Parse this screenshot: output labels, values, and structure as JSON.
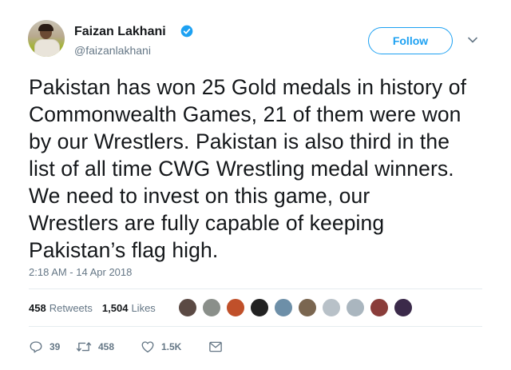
{
  "author": {
    "name": "Faizan Lakhani",
    "handle": "@faizanlakhani",
    "verified": true
  },
  "follow_button": {
    "label": "Follow"
  },
  "tweet": {
    "lines": [
      "Pakistan has won 25 Gold medals in history of",
      "Commonwealth Games, 21 of them were won",
      "by our Wrestlers. Pakistan is also third in the",
      "list of all time CWG Wrestling medal winners.",
      "We need to invest on this game, our",
      "Wrestlers are fully capable of keeping",
      "Pakistan’s flag high."
    ],
    "timestamp": "2:18 AM - 14 Apr 2018"
  },
  "stats": {
    "retweets_count": "458",
    "retweets_label": "Retweets",
    "likes_count": "1,504",
    "likes_label": "Likes"
  },
  "liker_avatars": [
    {
      "color": "#5b4a44"
    },
    {
      "color": "#8a8f8a"
    },
    {
      "color": "#c0502a"
    },
    {
      "color": "#222222"
    },
    {
      "color": "#6d8fa8"
    },
    {
      "color": "#7a6650"
    },
    {
      "color": "#b8c1c8"
    },
    {
      "color": "#aab6bf"
    },
    {
      "color": "#8a3d3a"
    },
    {
      "color": "#3b2a4a"
    }
  ],
  "actions": {
    "reply_count": "39",
    "retweet_count": "458",
    "like_count": "1.5K"
  },
  "colors": {
    "accent": "#1da1f2",
    "text": "#14171a",
    "muted": "#657786",
    "divider": "#e6ecf0"
  }
}
